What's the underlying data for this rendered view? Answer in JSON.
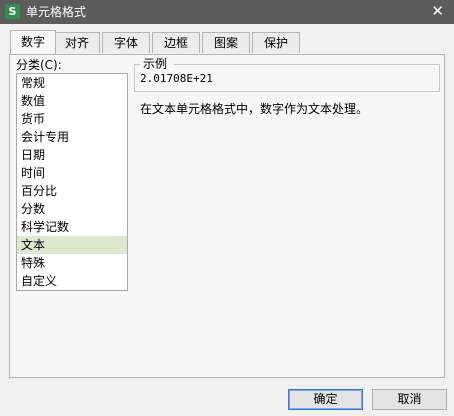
{
  "window": {
    "title": "单元格格式",
    "app_icon_glyph": "S"
  },
  "tabs": [
    {
      "label": "数字",
      "active": true
    },
    {
      "label": "对齐",
      "active": false
    },
    {
      "label": "字体",
      "active": false
    },
    {
      "label": "边框",
      "active": false
    },
    {
      "label": "图案",
      "active": false
    },
    {
      "label": "保护",
      "active": false
    }
  ],
  "category": {
    "label": "分类(C):",
    "items": [
      "常规",
      "数值",
      "货币",
      "会计专用",
      "日期",
      "时间",
      "百分比",
      "分数",
      "科学记数",
      "文本",
      "特殊",
      "自定义"
    ],
    "selected": "文本"
  },
  "sample": {
    "label": "示例",
    "value": "2.01708E+21"
  },
  "description": "在文本单元格格式中，数字作为文本处理。",
  "buttons": {
    "ok": "确定",
    "cancel": "取消"
  },
  "colors": {
    "titlebar": "#5b5b5b",
    "selection": "#dde8cf",
    "app_icon": "#2f8f4a"
  }
}
